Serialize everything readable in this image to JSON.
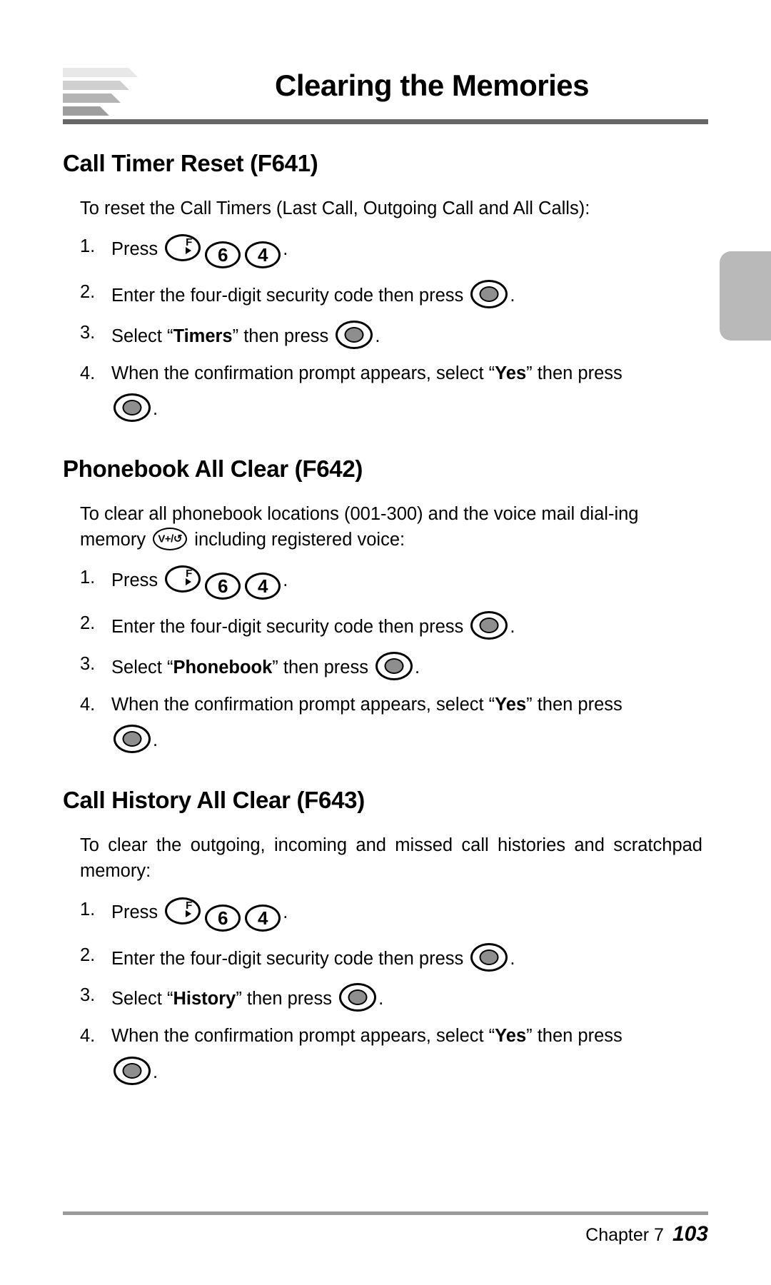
{
  "header": {
    "title": "Clearing the Memories",
    "logo_name": "speed-stripes-logo"
  },
  "sections": [
    {
      "title": "Call Timer Reset (F641)",
      "intro": "To reset the Call Timers (Last Call, Outgoing Call and All Calls):",
      "steps": [
        {
          "num": "1.",
          "pre": "Press",
          "keys": [
            "F",
            "6",
            "4"
          ],
          "post": "."
        },
        {
          "num": "2.",
          "pre": "Enter the four-digit security code then press",
          "post": "."
        },
        {
          "num": "3.",
          "pre_a": "Select “",
          "bold": "Timers",
          "pre_b": "” then press",
          "post": "."
        },
        {
          "num": "4.",
          "pre_a": "When the confirmation prompt appears, select “",
          "bold": "Yes",
          "pre_b": "” then press",
          "post": "."
        }
      ]
    },
    {
      "title": "Phonebook All Clear (F642)",
      "intro_a": "To clear all phonebook locations (001-300) and the voice mail dial-ing memory",
      "intro_b": "including registered voice:",
      "steps": [
        {
          "num": "1.",
          "pre": "Press",
          "keys": [
            "F",
            "6",
            "4"
          ],
          "post": "."
        },
        {
          "num": "2.",
          "pre": "Enter the four-digit security code then press",
          "post": "."
        },
        {
          "num": "3.",
          "pre_a": "Select “",
          "bold": "Phonebook",
          "pre_b": "” then press",
          "post": "."
        },
        {
          "num": "4.",
          "pre_a": "When the confirmation prompt appears, select “",
          "bold": "Yes",
          "pre_b": "” then press",
          "post": "."
        }
      ]
    },
    {
      "title": "Call History All Clear (F643)",
      "intro": "To clear the outgoing, incoming and missed call histories and scratchpad memory:",
      "steps": [
        {
          "num": "1.",
          "pre": "Press",
          "keys": [
            "F",
            "6",
            "4"
          ],
          "post": "."
        },
        {
          "num": "2.",
          "pre": "Enter the four-digit security code then press",
          "post": "."
        },
        {
          "num": "3.",
          "pre_a": "Select “",
          "bold": "History",
          "pre_b": "” then press",
          "post": "."
        },
        {
          "num": "4.",
          "pre_a": "When the confirmation prompt appears, select “",
          "bold": "Yes",
          "pre_b": "” then press",
          "post": "."
        }
      ]
    }
  ],
  "keys": {
    "func_label": "F",
    "six_label": "6",
    "four_label": "4",
    "voice_label": "V+/↺"
  },
  "footer": {
    "chapter": "Chapter 7",
    "page": "103"
  },
  "colors": {
    "rule": "#666666",
    "footer_rule": "#9a9a9a",
    "tab": "#b9b9b9",
    "key_disc": "#8e8e8e"
  }
}
